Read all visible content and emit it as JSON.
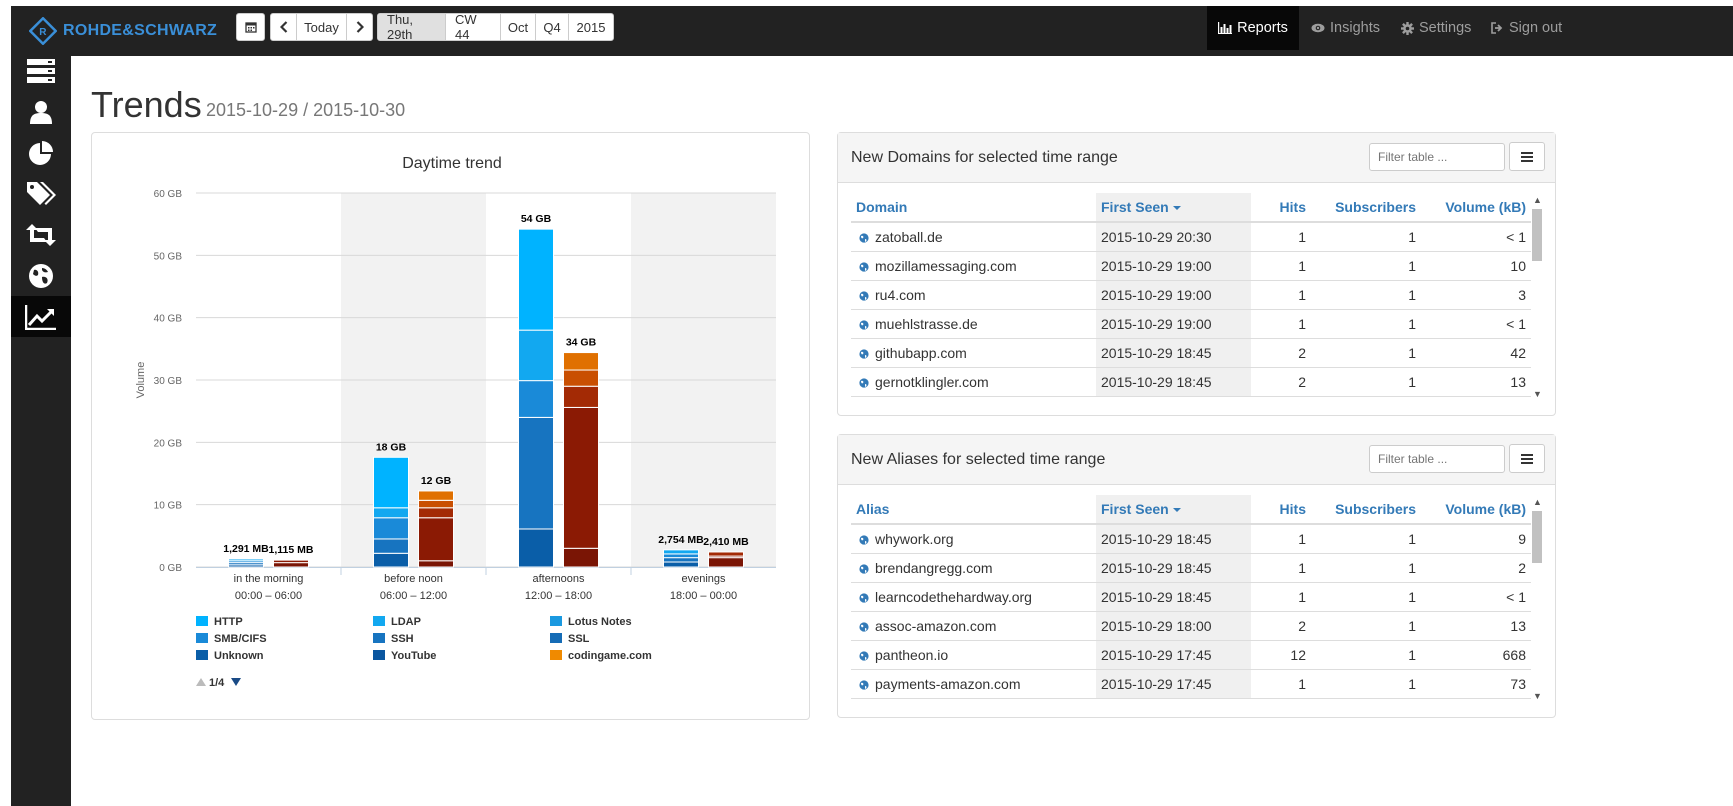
{
  "brand": {
    "name": "ROHDE&SCHWARZ"
  },
  "toolbar": {
    "today_label": "Today",
    "date_segments": [
      "Thu, 29th",
      "CW 44",
      "Oct",
      "Q4",
      "2015"
    ],
    "active_segment": "Thu, 29th"
  },
  "nav": {
    "reports": "Reports",
    "insights": "Insights",
    "settings": "Settings",
    "signout": "Sign out"
  },
  "sidebar": {
    "items": [
      {
        "icon": "server-icon"
      },
      {
        "icon": "user-icon"
      },
      {
        "icon": "pie-chart-icon"
      },
      {
        "icon": "tags-icon"
      },
      {
        "icon": "retweet-icon"
      },
      {
        "icon": "globe-icon"
      },
      {
        "icon": "trend-line-icon",
        "active": true
      }
    ]
  },
  "page": {
    "title": "Trends",
    "range": "2015-10-29 / 2015-10-30"
  },
  "chart_data": {
    "type": "bar",
    "title": "Daytime trend",
    "ylabel": "Volume",
    "ylim": [
      0,
      60
    ],
    "yticks": [
      "0 GB",
      "10 GB",
      "20 GB",
      "30 GB",
      "40 GB",
      "50 GB",
      "60 GB"
    ],
    "categories": [
      "in the morning",
      "before noon",
      "afternoons",
      "evenings"
    ],
    "category_times": [
      "00:00 – 06:00",
      "06:00 – 12:00",
      "12:00 – 18:00",
      "18:00 – 00:00"
    ],
    "stacks": [
      {
        "group": "blue",
        "totals": [
          1.291,
          17.6,
          54.2,
          2.754
        ],
        "total_labels": [
          "1,291 MB",
          "18 GB",
          "54 GB",
          "2,754 MB"
        ],
        "segments_gb": [
          [
            0.35,
            0.35,
            0.3,
            0.29
          ],
          [
            2.2,
            2.3,
            3.4,
            1.6,
            8.1
          ],
          [
            6.1,
            17.9,
            5.9,
            8.1,
            16.2
          ],
          [
            0.8,
            0.7,
            0.6,
            0.65
          ]
        ],
        "colors": [
          "#0a5ea8",
          "#1774c0",
          "#1a8ad8",
          "#12a8f0",
          "#00b3ff"
        ]
      },
      {
        "group": "red",
        "totals": [
          1.115,
          12.2,
          34.4,
          2.41
        ],
        "total_labels": [
          "1,115 MB",
          "12 GB",
          "34 GB",
          "2,410 MB"
        ],
        "segments_gb": [
          [
            0.7,
            0.4
          ],
          [
            1.0,
            6.9,
            1.6,
            1.2,
            1.5
          ],
          [
            3.0,
            22.6,
            3.4,
            2.6,
            2.8
          ],
          [
            1.5,
            0.25,
            0.66
          ]
        ],
        "colors": [
          "#7a1505",
          "#8b1a04",
          "#a32a05",
          "#c94f02",
          "#e07000"
        ]
      }
    ],
    "legend": [
      {
        "name": "HTTP",
        "color": "#00b3ff"
      },
      {
        "name": "LDAP",
        "color": "#12a8f0"
      },
      {
        "name": "Lotus Notes",
        "color": "#1a99e0"
      },
      {
        "name": "SMB/CIFS",
        "color": "#1a8ad8"
      },
      {
        "name": "SSH",
        "color": "#1774c0"
      },
      {
        "name": "SSL",
        "color": "#156cb6"
      },
      {
        "name": "Unknown",
        "color": "#0a5ea8"
      },
      {
        "name": "YouTube",
        "color": "#0a56a0"
      },
      {
        "name": "codingame.com",
        "color": "#f08a00"
      }
    ],
    "legend_pager": "1/4"
  },
  "domains_table": {
    "title": "New Domains for selected time range",
    "filter_placeholder": "Filter table ...",
    "columns": [
      "Domain",
      "First Seen",
      "Hits",
      "Subscribers",
      "Volume (kB)"
    ],
    "rows": [
      [
        "zatoball.de",
        "2015-10-29 20:30",
        "1",
        "1",
        "< 1"
      ],
      [
        "mozillamessaging.com",
        "2015-10-29 19:00",
        "1",
        "1",
        "10"
      ],
      [
        "ru4.com",
        "2015-10-29 19:00",
        "1",
        "1",
        "3"
      ],
      [
        "muehlstrasse.de",
        "2015-10-29 19:00",
        "1",
        "1",
        "< 1"
      ],
      [
        "githubapp.com",
        "2015-10-29 18:45",
        "2",
        "1",
        "42"
      ],
      [
        "gernotklingler.com",
        "2015-10-29 18:45",
        "2",
        "1",
        "13"
      ]
    ]
  },
  "aliases_table": {
    "title": "New Aliases for selected time range",
    "filter_placeholder": "Filter table ...",
    "columns": [
      "Alias",
      "First Seen",
      "Hits",
      "Subscribers",
      "Volume (kB)"
    ],
    "rows": [
      [
        "whywork.org",
        "2015-10-29 18:45",
        "1",
        "1",
        "9"
      ],
      [
        "brendangregg.com",
        "2015-10-29 18:45",
        "1",
        "1",
        "2"
      ],
      [
        "learncodethehardway.org",
        "2015-10-29 18:45",
        "1",
        "1",
        "< 1"
      ],
      [
        "assoc-amazon.com",
        "2015-10-29 18:00",
        "2",
        "1",
        "13"
      ],
      [
        "pantheon.io",
        "2015-10-29 17:45",
        "12",
        "1",
        "668"
      ],
      [
        "payments-amazon.com",
        "2015-10-29 17:45",
        "1",
        "1",
        "73"
      ]
    ]
  }
}
